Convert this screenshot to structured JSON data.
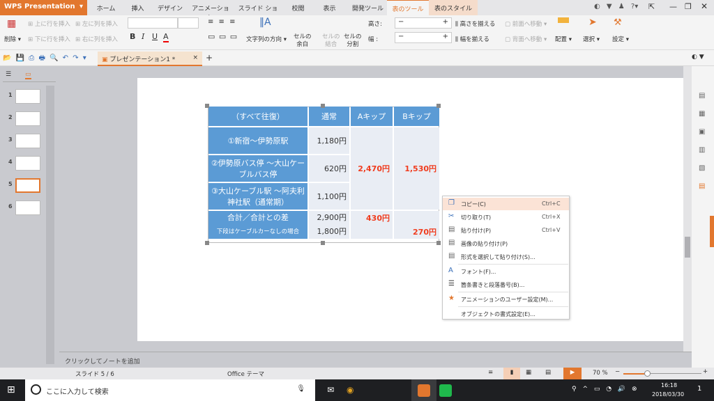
{
  "app": {
    "name": "WPS Presentation"
  },
  "tabs": [
    "ホーム",
    "挿入",
    "デザイン",
    "アニメーション",
    "スライド ショー",
    "校閲",
    "表示",
    "開発ツール",
    "表のツール",
    "表のスタイル"
  ],
  "active_tab": "表のツール",
  "ribbon": {
    "delete": "削除",
    "insert_row_above": "上に行を挿入",
    "insert_row_below": "下に行を挿入",
    "insert_col_left": "左に列を挿入",
    "insert_col_right": "右に列を挿入",
    "bold": "B",
    "italic": "I",
    "underline": "U",
    "font_color": "A",
    "text_direction": "文字列の方向",
    "cell_margin_1": "セルの",
    "cell_margin_2": "余白",
    "merge_1": "セルの",
    "merge_2": "結合",
    "split_1": "セルの",
    "split_2": "分割",
    "height_label": "高さ:",
    "width_label": "幅 :",
    "minus": "−",
    "plus": "+",
    "equal_height": "高さを揃える",
    "equal_width": "幅を揃える",
    "bring_forward": "前面へ移動",
    "send_backward": "背面へ移動",
    "arrange": "配置",
    "select": "選択",
    "settings": "設定"
  },
  "document_tab": {
    "title": "プレゼンテーション1 *",
    "close": "×",
    "new": "+"
  },
  "slides": [
    "1",
    "2",
    "3",
    "4",
    "5",
    "6"
  ],
  "current_slide": 5,
  "table": {
    "header": [
      "（すべて往復）",
      "通常",
      "Aキップ",
      "Bキップ"
    ],
    "rows": [
      {
        "label": "①新宿～伊勢原駅",
        "normal": "1,180円"
      },
      {
        "label": "②伊勢原バス停 ～大山ケーブルバス停",
        "normal": "620円"
      },
      {
        "label": "③大山ケーブル駅 ～阿夫利神社駅（通常期）",
        "normal": "1,100円"
      }
    ],
    "a_total": "2,470円",
    "b_total": "1,530円",
    "sum_label": "合計／合計との差",
    "sum_sub_label": "下段はケーブルカーなしの場合",
    "sum_normal": "2,900円",
    "sum_normal_sub": "1,800円",
    "a_diff": "430円",
    "b_diff": "270円"
  },
  "context_menu": [
    {
      "label": "コピー(C)",
      "shortcut": "Ctrl+C",
      "icon": "copy-icon"
    },
    {
      "label": "切り取り(T)",
      "shortcut": "Ctrl+X",
      "icon": "cut-icon"
    },
    {
      "label": "貼り付け(P)",
      "shortcut": "Ctrl+V",
      "icon": "paste-icon"
    },
    {
      "label": "画像の貼り付け(P)",
      "shortcut": "",
      "icon": "paste-image-icon"
    },
    {
      "label": "形式を選択して貼り付け(S)...",
      "shortcut": "",
      "icon": "paste-special-icon"
    },
    {
      "label": "フォント(F)...",
      "shortcut": "",
      "icon": "font-icon"
    },
    {
      "label": "箇条書きと段落番号(B)...",
      "shortcut": "",
      "icon": "bullets-icon"
    },
    {
      "label": "アニメーションのユーザー設定(M)...",
      "shortcut": "",
      "icon": "animation-icon"
    },
    {
      "label": "オブジェクトの書式設定(E)...",
      "shortcut": "",
      "icon": ""
    }
  ],
  "notes_placeholder": "クリックしてノートを追加",
  "status": {
    "slide": "スライド 5 / 6",
    "theme": "Office テーマ",
    "zoom": "70 %",
    "zoom_value": 70
  },
  "taskbar": {
    "search": "ここに入力して検索",
    "time": "16:18",
    "date": "2018/03/30",
    "notif": "1"
  },
  "accent": "#e2772e",
  "table_header_color": "#5b9bd5"
}
